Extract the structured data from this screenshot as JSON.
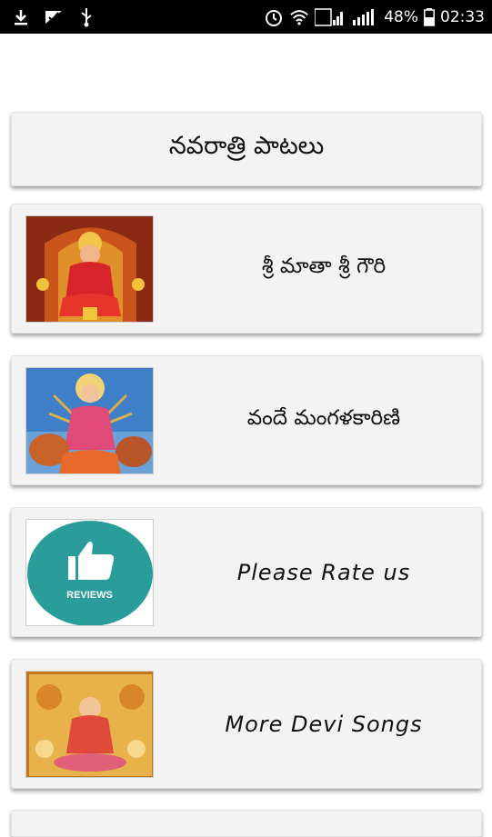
{
  "status_bar": {
    "battery": "48%",
    "time": "02:33",
    "icons": [
      "download-icon",
      "checkmark-icon",
      "usb-icon",
      "alarm-icon",
      "wifi-icon",
      "signal-icon",
      "signal-icon",
      "battery-icon"
    ]
  },
  "header": {
    "title": "నవరాత్రి పాటలు"
  },
  "items": [
    {
      "label": "శ్రీ మాతా శ్రీ గౌరి",
      "thumbnail": "goddess-gauri-image"
    },
    {
      "label": "వందే మంగళకారిణి",
      "thumbnail": "goddess-durga-image"
    },
    {
      "label": "Please Rate us",
      "thumbnail": "reviews-thumbs-up-image",
      "badge_text": "REVIEWS"
    },
    {
      "label": "More Devi Songs",
      "thumbnail": "goddess-lakshmi-image"
    }
  ],
  "colors": {
    "status_bar": "#000000",
    "card_bg": "#f3f3f3",
    "reviews_circle": "#2a9d9a"
  }
}
